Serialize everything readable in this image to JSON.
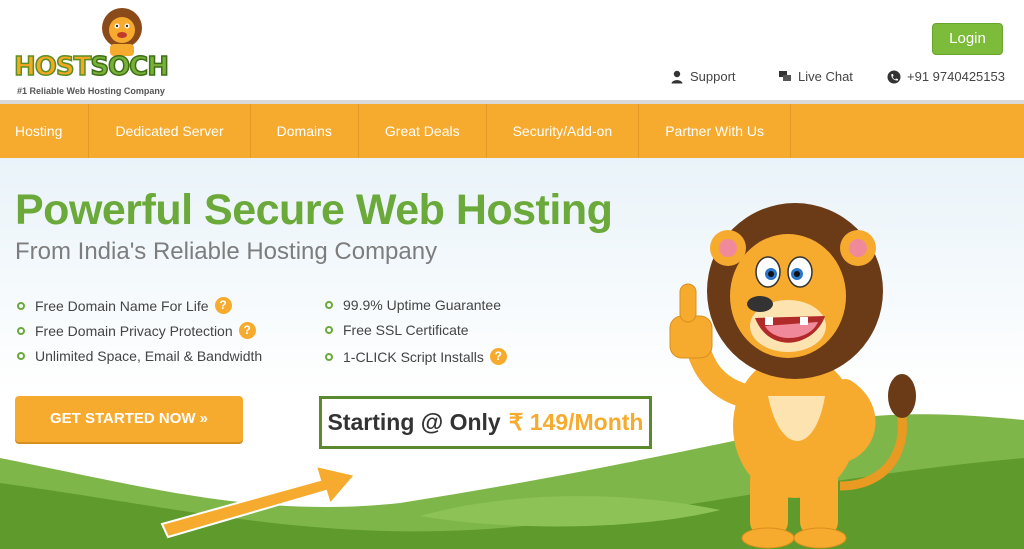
{
  "header": {
    "logo_text_host": "HOST",
    "logo_text_soch": "SOCH",
    "logo_tagline": "#1 Reliable Web Hosting Company",
    "login_label": "Login",
    "support_label": "Support",
    "live_chat_label": "Live Chat",
    "phone_label": "+91 9740425153"
  },
  "nav": {
    "items": [
      {
        "label": "Hosting"
      },
      {
        "label": "Dedicated Server"
      },
      {
        "label": "Domains"
      },
      {
        "label": "Great Deals"
      },
      {
        "label": "Security/Add-on"
      },
      {
        "label": "Partner With Us"
      }
    ]
  },
  "hero": {
    "title": "Powerful Secure Web Hosting",
    "subtitle": "From India's Reliable Hosting Company",
    "features_left": [
      {
        "label": "Free Domain Name For Life",
        "help": "?"
      },
      {
        "label": "Free Domain Privacy Protection",
        "help": "?"
      },
      {
        "label": "Unlimited Space, Email & Bandwidth"
      }
    ],
    "features_right": [
      {
        "label": "99.9% Uptime Guarantee"
      },
      {
        "label": "Free SSL Certificate"
      },
      {
        "label": "1-CLICK Script Installs",
        "help": "?"
      }
    ],
    "cta_label": "GET STARTED NOW »",
    "price_prefix": "Starting @ Only",
    "price_value": "₹ 149/Month"
  },
  "colors": {
    "brand_orange": "#f7ab2e",
    "brand_green": "#6aa93a",
    "login_green": "#7cbc3a"
  }
}
